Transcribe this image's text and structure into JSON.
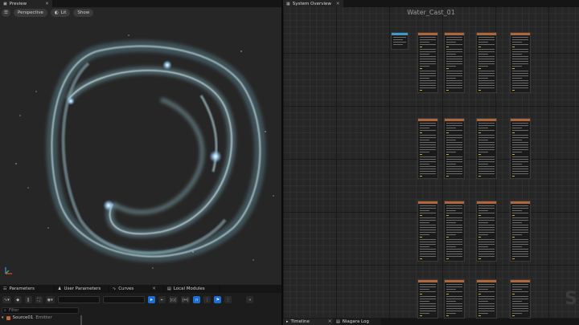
{
  "preview": {
    "tab_label": "Preview",
    "toolbar": {
      "perspective": "Perspective",
      "lit": "Lit",
      "show": "Show"
    }
  },
  "bottom_left": {
    "tabs": [
      "Parameters",
      "User Parameters",
      "Curves",
      "Local Modules"
    ],
    "filter_placeholder": "Filter",
    "source_name": "Source01",
    "source_kind": "Emitter"
  },
  "system_overview": {
    "tab_label": "System Overview",
    "graph_title": "Water_Cast_01",
    "watermark": "S",
    "bottom_tabs": [
      "Timeline",
      "Niagara Log"
    ]
  },
  "colors": {
    "node_header": "#b0653a",
    "system_node_header": "#3a9bcf",
    "accent_blue": "#1d6fd1"
  }
}
